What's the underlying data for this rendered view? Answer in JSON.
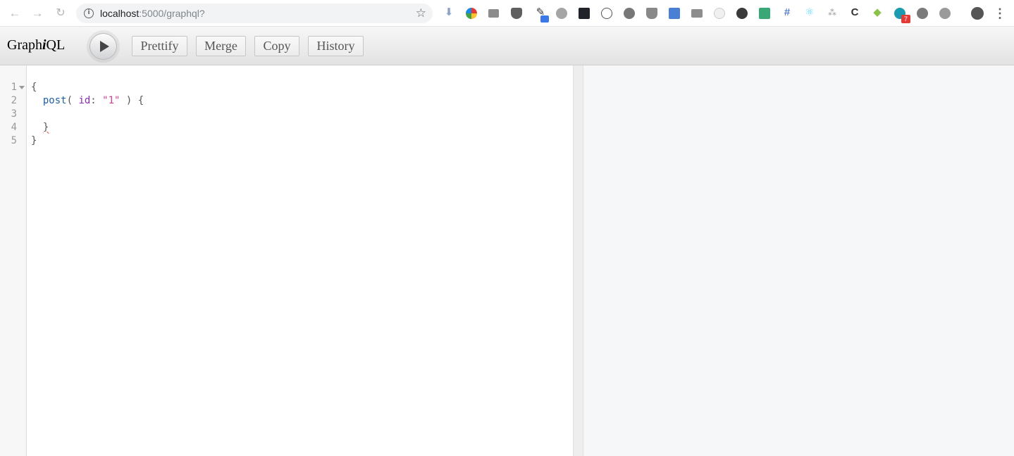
{
  "browser": {
    "url_host": "localhost",
    "url_rest": ":5000/graphql?",
    "back_glyph": "←",
    "forward_glyph": "→",
    "reload_glyph": "↻",
    "star_glyph": "☆",
    "menu_glyph": "⋮",
    "ext_badge_count": "7"
  },
  "toolbar": {
    "logo_pre": "Graph",
    "logo_em": "i",
    "logo_post": "QL",
    "buttons": {
      "prettify": "Prettify",
      "merge": "Merge",
      "copy": "Copy",
      "history": "History"
    }
  },
  "editor": {
    "line_numbers": [
      "1",
      "2",
      "3",
      "4",
      "5"
    ],
    "lines": {
      "l1": "{",
      "l2_field": "post",
      "l2_open": "( ",
      "l2_attr": "id",
      "l2_colon": ": ",
      "l2_str": "\"1\"",
      "l2_close": " ) {",
      "l4": "}",
      "l5": "}"
    }
  },
  "colors": {
    "field": "#1f61a0",
    "attribute": "#8b2bb9",
    "string": "#d64292",
    "error_squiggle": "#e53935"
  }
}
